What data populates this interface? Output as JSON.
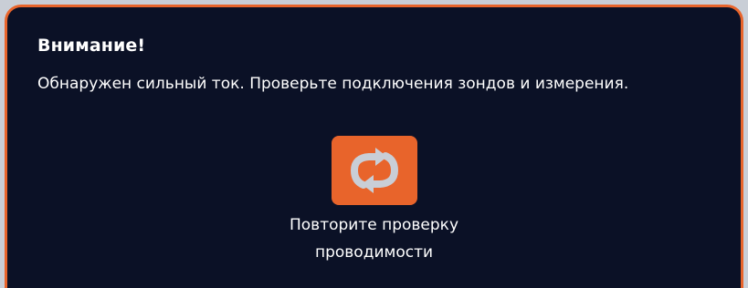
{
  "colors": {
    "accent": "#e8642b",
    "panel_background": "#0b1126",
    "text": "#ffffff",
    "icon": "#c9ced6"
  },
  "dialog": {
    "title": "Внимание!",
    "message": "Обнаружен сильный ток. Проверьте подключения зондов и измерения."
  },
  "retry": {
    "icon": "refresh-icon",
    "label_line1": "Повторите проверку",
    "label_line2": "проводимости"
  }
}
